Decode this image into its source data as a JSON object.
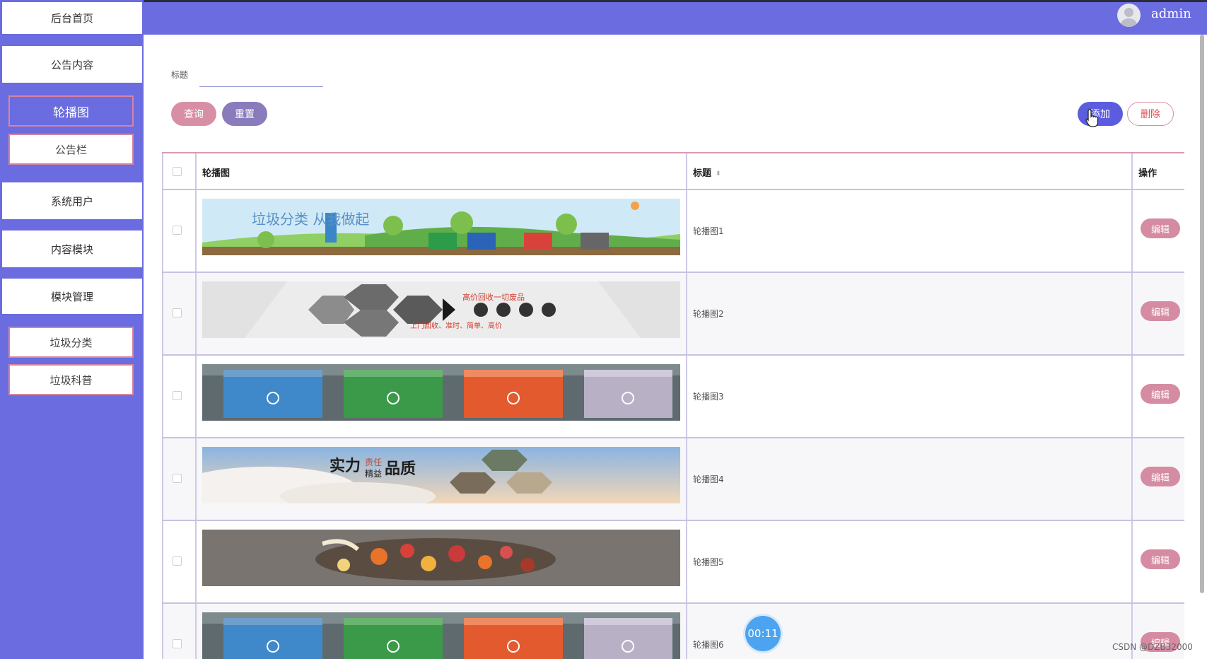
{
  "header": {
    "username": "admin"
  },
  "sidebar": {
    "items": [
      {
        "label": "后台首页"
      },
      {
        "label": "公告内容"
      },
      {
        "label": "轮播图"
      },
      {
        "label": "公告栏"
      },
      {
        "label": "系统用户"
      },
      {
        "label": "内容模块"
      },
      {
        "label": "模块管理"
      },
      {
        "label": "垃圾分类"
      },
      {
        "label": "垃圾科普"
      }
    ],
    "active": "轮播图"
  },
  "filter": {
    "title_label": "标题",
    "title_value": ""
  },
  "toolbar": {
    "query": "查询",
    "reset": "重置",
    "add": "添加",
    "delete": "删除"
  },
  "table": {
    "columns": {
      "image": "轮播图",
      "title": "标题",
      "actions": "操作"
    },
    "edit_label": "编辑",
    "rows": [
      {
        "title": "轮播图1",
        "banner": {
          "kind": "landscape",
          "caption": "垃圾分类 从我做起"
        }
      },
      {
        "title": "轮播图2",
        "banner": {
          "kind": "recycle",
          "headline": "高价回收一切废品",
          "subline": "上门回收、准时、简单、高价"
        }
      },
      {
        "title": "轮播图3",
        "banner": {
          "kind": "bins"
        }
      },
      {
        "title": "轮播图4",
        "banner": {
          "kind": "sky",
          "caption_a": "实力",
          "caption_b": "责任",
          "caption_c": "精益",
          "caption_d": "品质"
        }
      },
      {
        "title": "轮播图5",
        "banner": {
          "kind": "food"
        }
      },
      {
        "title": "轮播图6",
        "banner": {
          "kind": "bins"
        }
      }
    ]
  },
  "overlay": {
    "timer": "00:11",
    "watermark": "CSDN @DZB32000"
  },
  "colors": {
    "accent": "#6a6cdf",
    "pink": "#d88fa6",
    "purple": "#8a7bbd",
    "danger": "#e04d4d"
  }
}
